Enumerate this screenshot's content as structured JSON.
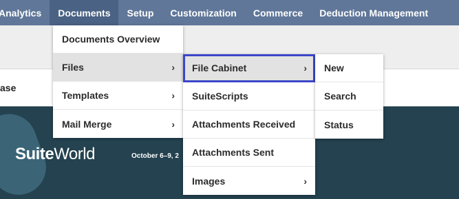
{
  "nav": {
    "items": [
      {
        "label": "Analytics"
      },
      {
        "label": "Documents"
      },
      {
        "label": "Setup"
      },
      {
        "label": "Customization"
      },
      {
        "label": "Commerce"
      },
      {
        "label": "Deduction Management"
      }
    ]
  },
  "page": {
    "partial_text": "ase"
  },
  "banner": {
    "logo_bold": "Suite",
    "logo_light": "World",
    "date_text": "October 6–9, 2"
  },
  "documents_menu": {
    "items": [
      {
        "label": "Documents Overview"
      },
      {
        "label": "Files",
        "chevron": "›"
      },
      {
        "label": "Templates",
        "chevron": "›"
      },
      {
        "label": "Mail Merge",
        "chevron": "›"
      }
    ]
  },
  "files_menu": {
    "items": [
      {
        "label": "File Cabinet",
        "chevron": "›"
      },
      {
        "label": "SuiteScripts"
      },
      {
        "label": "Attachments Received"
      },
      {
        "label": "Attachments Sent"
      },
      {
        "label": "Images",
        "chevron": "›"
      }
    ]
  },
  "file_cabinet_menu": {
    "items": [
      {
        "label": "New"
      },
      {
        "label": "Search"
      },
      {
        "label": "Status"
      }
    ]
  }
}
